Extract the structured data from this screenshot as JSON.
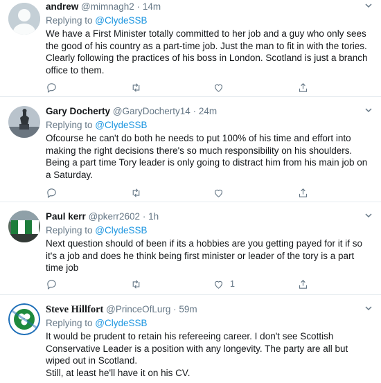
{
  "tweets": [
    {
      "name": "andrew",
      "handle": "@mimnagh2",
      "dot": "·",
      "time": "14m",
      "replying_prefix": "Replying to ",
      "replying_to": "@ClydeSSB",
      "text": "We have a First Minister totally committed to her job  and a guy who only sees the good of his country as a part-time job. Just the man to fit in with the tories. Clearly following the practices of his boss in London. Scotland is just a branch office to them.",
      "likes": ""
    },
    {
      "name": "Gary Docherty",
      "handle": "@GaryDocherty14",
      "dot": "·",
      "time": "24m",
      "replying_prefix": "Replying to ",
      "replying_to": "@ClydeSSB",
      "text": "Ofcourse he can't do both he needs to put 100% of his time and effort into making the right decisions there's so much responsibility on his shoulders. Being a part time Tory leader is only going to distract him from his main job on a Saturday.",
      "likes": ""
    },
    {
      "name": "Paul kerr",
      "handle": "@pkerr2602",
      "dot": "·",
      "time": "1h",
      "replying_prefix": "Replying to ",
      "replying_to": "@ClydeSSB",
      "text": "Next question should of been if its a hobbies are you getting payed for it if so it's a job and does he think being first minister or leader of the tory is a part time job",
      "likes": "1"
    },
    {
      "name": "Steve Hillfort",
      "handle": "@PrinceOfLurg",
      "dot": "·",
      "time": "59m",
      "replying_prefix": "Replying to ",
      "replying_to": "@ClydeSSB",
      "text_lines": [
        "It would be prudent to retain his refereeing career. I don't see Scottish Conservative Leader is a position with any longevity. The party are all but wiped out in Scotland.",
        "Still, at least he'll have it on his CV."
      ],
      "likes": ""
    }
  ],
  "icons": {
    "reply": "reply-icon",
    "retweet": "retweet-icon",
    "like": "heart-icon",
    "share": "share-icon",
    "more": "chevron-down-icon"
  },
  "colors": {
    "link": "#1b95e0",
    "secondary": "#657786",
    "divider": "#e6ecf0"
  }
}
